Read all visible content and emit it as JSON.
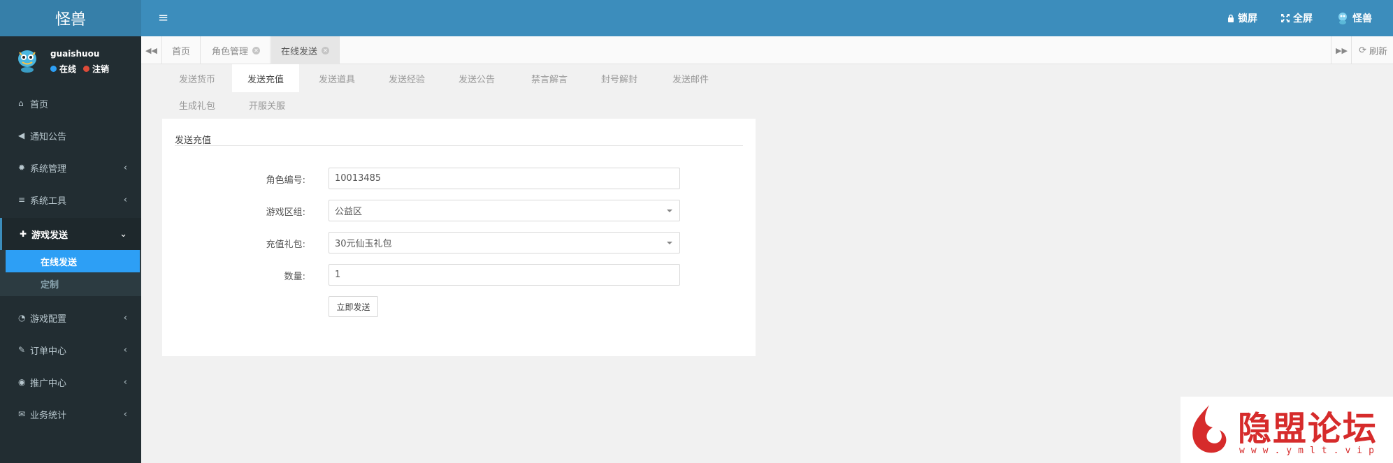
{
  "header": {
    "logo": "怪兽",
    "lock_label": "锁屏",
    "fullscreen_label": "全屏",
    "user_label": "怪兽"
  },
  "sidebar": {
    "user": {
      "name": "guaishuou",
      "status": "在线",
      "logout": "注销"
    },
    "items": [
      {
        "label": "首页",
        "icon": "home-icon"
      },
      {
        "label": "通知公告",
        "icon": "bullhorn-icon"
      },
      {
        "label": "系统管理",
        "icon": "gear-icon"
      },
      {
        "label": "系统工具",
        "icon": "list-icon"
      },
      {
        "label": "游戏发送",
        "icon": "gift-icon"
      },
      {
        "label": "游戏配置",
        "icon": "dashboard-icon"
      },
      {
        "label": "订单中心",
        "icon": "brush-icon"
      },
      {
        "label": "推广中心",
        "icon": "eye-icon"
      },
      {
        "label": "业务统计",
        "icon": "envelope-icon"
      }
    ],
    "subitems": [
      {
        "label": "在线发送"
      },
      {
        "label": "定制"
      }
    ]
  },
  "page_tabs": [
    {
      "label": "首页"
    },
    {
      "label": "角色管理"
    },
    {
      "label": "在线发送"
    }
  ],
  "refresh_label": "刷新",
  "function_tabs": [
    "发送货币",
    "发送充值",
    "发送道具",
    "发送经验",
    "发送公告",
    "禁言解言",
    "封号解封",
    "发送邮件",
    "生成礼包",
    "开服关服"
  ],
  "form": {
    "title": "发送充值",
    "fields": [
      {
        "label": "角色编号:",
        "value": "10013485"
      },
      {
        "label": "游戏区组:",
        "value": "公益区"
      },
      {
        "label": "充值礼包:",
        "value": "30元仙玉礼包"
      },
      {
        "label": "数量:",
        "value": "1"
      }
    ],
    "submit_label": "立即发送"
  },
  "watermark": {
    "text": "隐盟论坛",
    "url": "www.ymlt.vip"
  },
  "colors": {
    "header": "#3c8dbc",
    "sidebar": "#222d32",
    "active_sub": "#2d9ff5"
  }
}
